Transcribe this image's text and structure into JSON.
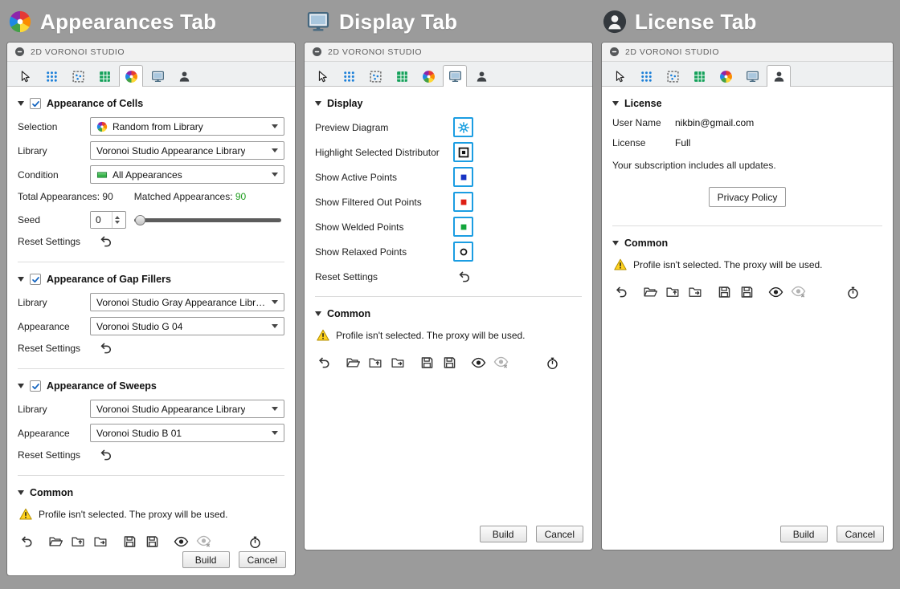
{
  "columns": [
    {
      "title": "Appearances Tab"
    },
    {
      "title": "Display Tab"
    },
    {
      "title": "License Tab"
    }
  ],
  "panel": {
    "header_title": "2D VORONOI STUDIO"
  },
  "appearances": {
    "cells": {
      "title": "Appearance of Cells",
      "labels": {
        "selection": "Selection",
        "library": "Library",
        "condition": "Condition",
        "seed": "Seed",
        "reset": "Reset Settings"
      },
      "values": {
        "selection": "Random from Library",
        "library": "Voronoi Studio Appearance Library",
        "condition": "All Appearances",
        "seed": "0"
      },
      "total_label": "Total Appearances:",
      "total_value": "90",
      "matched_label": "Matched Appearances:",
      "matched_value": "90"
    },
    "gap_fillers": {
      "title": "Appearance of Gap Fillers",
      "labels": {
        "library": "Library",
        "appearance": "Appearance",
        "reset": "Reset Settings"
      },
      "values": {
        "library": "Voronoi Studio Gray Appearance Library",
        "appearance": "Voronoi Studio G 04"
      }
    },
    "sweeps": {
      "title": "Appearance of Sweeps",
      "labels": {
        "library": "Library",
        "appearance": "Appearance",
        "reset": "Reset Settings"
      },
      "values": {
        "library": "Voronoi Studio Appearance Library",
        "appearance": "Voronoi Studio B 01"
      }
    }
  },
  "display": {
    "title": "Display",
    "rows": [
      {
        "label": "Preview Diagram"
      },
      {
        "label": "Highlight Selected Distributor"
      },
      {
        "label": "Show Active Points"
      },
      {
        "label": "Show Filtered Out Points"
      },
      {
        "label": "Show Welded Points"
      },
      {
        "label": "Show Relaxed Points"
      }
    ],
    "reset": "Reset Settings"
  },
  "license": {
    "title": "License",
    "user_name_label": "User Name",
    "user_name_value": "nikbin@gmail.com",
    "license_label": "License",
    "license_value": "Full",
    "subscription": "Your subscription includes all updates.",
    "privacy_button": "Privacy Policy"
  },
  "common": {
    "title": "Common",
    "warning": "Profile isn't selected. The proxy will be used."
  },
  "footer": {
    "build": "Build",
    "cancel": "Cancel"
  },
  "colors": {
    "background": "#9b9b9b",
    "toggle_border_blue": "#1b9de2",
    "matched_green": "#1f9d1f",
    "warning_yellow": "#ffd21e",
    "active_points_blue": "#1733c4",
    "filtered_points_red": "#de1f14",
    "welded_points_green": "#12a53a"
  }
}
